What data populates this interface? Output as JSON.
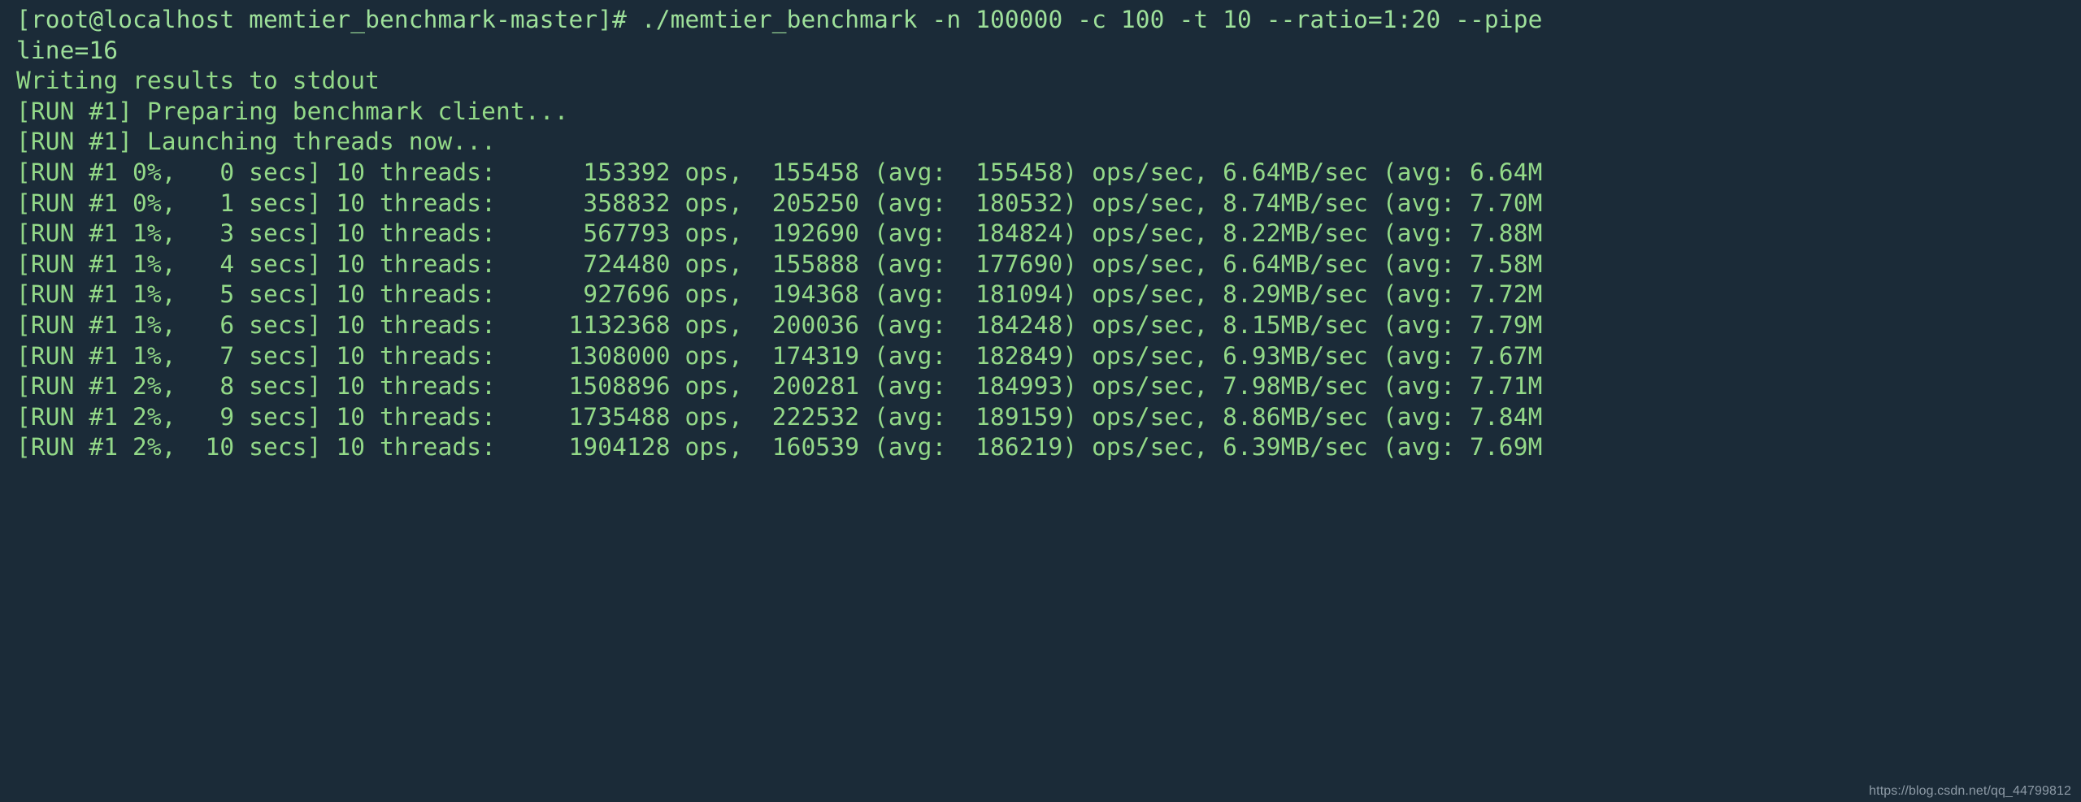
{
  "terminal": {
    "background_color": "#1b2b38",
    "foreground_color": "#93d988",
    "prompt": "[root@localhost memtier_benchmark-master]#",
    "command": "./memtier_benchmark -n 100000 -c 100 -t 10 --ratio=1:20 --pipeline=16",
    "lines": [
      "[root@localhost memtier_benchmark-master]# ./memtier_benchmark -n 100000 -c 100 -t 10 --ratio=1:20 --pipe",
      "line=16",
      "Writing results to stdout",
      "[RUN #1] Preparing benchmark client...",
      "[RUN #1] Launching threads now...",
      "[RUN #1 0%,   0 secs] 10 threads:      153392 ops,  155458 (avg:  155458) ops/sec, 6.64MB/sec (avg: 6.64M",
      "[RUN #1 0%,   1 secs] 10 threads:      358832 ops,  205250 (avg:  180532) ops/sec, 8.74MB/sec (avg: 7.70M",
      "[RUN #1 1%,   3 secs] 10 threads:      567793 ops,  192690 (avg:  184824) ops/sec, 8.22MB/sec (avg: 7.88M",
      "[RUN #1 1%,   4 secs] 10 threads:      724480 ops,  155888 (avg:  177690) ops/sec, 6.64MB/sec (avg: 7.58M",
      "[RUN #1 1%,   5 secs] 10 threads:      927696 ops,  194368 (avg:  181094) ops/sec, 8.29MB/sec (avg: 7.72M",
      "[RUN #1 1%,   6 secs] 10 threads:     1132368 ops,  200036 (avg:  184248) ops/sec, 8.15MB/sec (avg: 7.79M",
      "[RUN #1 1%,   7 secs] 10 threads:     1308000 ops,  174319 (avg:  182849) ops/sec, 6.93MB/sec (avg: 7.67M",
      "[RUN #1 2%,   8 secs] 10 threads:     1508896 ops,  200281 (avg:  184993) ops/sec, 7.98MB/sec (avg: 7.71M",
      "[RUN #1 2%,   9 secs] 10 threads:     1735488 ops,  222532 (avg:  189159) ops/sec, 8.86MB/sec (avg: 7.84M",
      "[RUN #1 2%,  10 secs] 10 threads:     1904128 ops,  160539 (avg:  186219) ops/sec, 6.39MB/sec (avg: 7.69M"
    ],
    "progress_rows": [
      {
        "run": "#1",
        "percent": "0%",
        "secs": "0",
        "threads": "10",
        "ops": "153392",
        "ops_sec": "155458",
        "ops_sec_avg": "155458",
        "mb_sec": "6.64MB/sec",
        "mb_sec_avg": "6.64M"
      },
      {
        "run": "#1",
        "percent": "0%",
        "secs": "1",
        "threads": "10",
        "ops": "358832",
        "ops_sec": "205250",
        "ops_sec_avg": "180532",
        "mb_sec": "8.74MB/sec",
        "mb_sec_avg": "7.70M"
      },
      {
        "run": "#1",
        "percent": "1%",
        "secs": "3",
        "threads": "10",
        "ops": "567793",
        "ops_sec": "192690",
        "ops_sec_avg": "184824",
        "mb_sec": "8.22MB/sec",
        "mb_sec_avg": "7.88M"
      },
      {
        "run": "#1",
        "percent": "1%",
        "secs": "4",
        "threads": "10",
        "ops": "724480",
        "ops_sec": "155888",
        "ops_sec_avg": "177690",
        "mb_sec": "6.64MB/sec",
        "mb_sec_avg": "7.58M"
      },
      {
        "run": "#1",
        "percent": "1%",
        "secs": "5",
        "threads": "10",
        "ops": "927696",
        "ops_sec": "194368",
        "ops_sec_avg": "181094",
        "mb_sec": "8.29MB/sec",
        "mb_sec_avg": "7.72M"
      },
      {
        "run": "#1",
        "percent": "1%",
        "secs": "6",
        "threads": "10",
        "ops": "1132368",
        "ops_sec": "200036",
        "ops_sec_avg": "184248",
        "mb_sec": "8.15MB/sec",
        "mb_sec_avg": "7.79M"
      },
      {
        "run": "#1",
        "percent": "1%",
        "secs": "7",
        "threads": "10",
        "ops": "1308000",
        "ops_sec": "174319",
        "ops_sec_avg": "182849",
        "mb_sec": "6.93MB/sec",
        "mb_sec_avg": "7.67M"
      },
      {
        "run": "#1",
        "percent": "2%",
        "secs": "8",
        "threads": "10",
        "ops": "1508896",
        "ops_sec": "200281",
        "ops_sec_avg": "184993",
        "mb_sec": "7.98MB/sec",
        "mb_sec_avg": "7.71M"
      },
      {
        "run": "#1",
        "percent": "2%",
        "secs": "9",
        "threads": "10",
        "ops": "1735488",
        "ops_sec": "222532",
        "ops_sec_avg": "189159",
        "mb_sec": "8.86MB/sec",
        "mb_sec_avg": "7.84M"
      },
      {
        "run": "#1",
        "percent": "2%",
        "secs": "10",
        "threads": "10",
        "ops": "1904128",
        "ops_sec": "160539",
        "ops_sec_avg": "186219",
        "mb_sec": "6.39MB/sec",
        "mb_sec_avg": "7.69M"
      }
    ]
  },
  "watermark": {
    "text": "https://blog.csdn.net/qq_44799812",
    "color": "#8d9aa6"
  }
}
